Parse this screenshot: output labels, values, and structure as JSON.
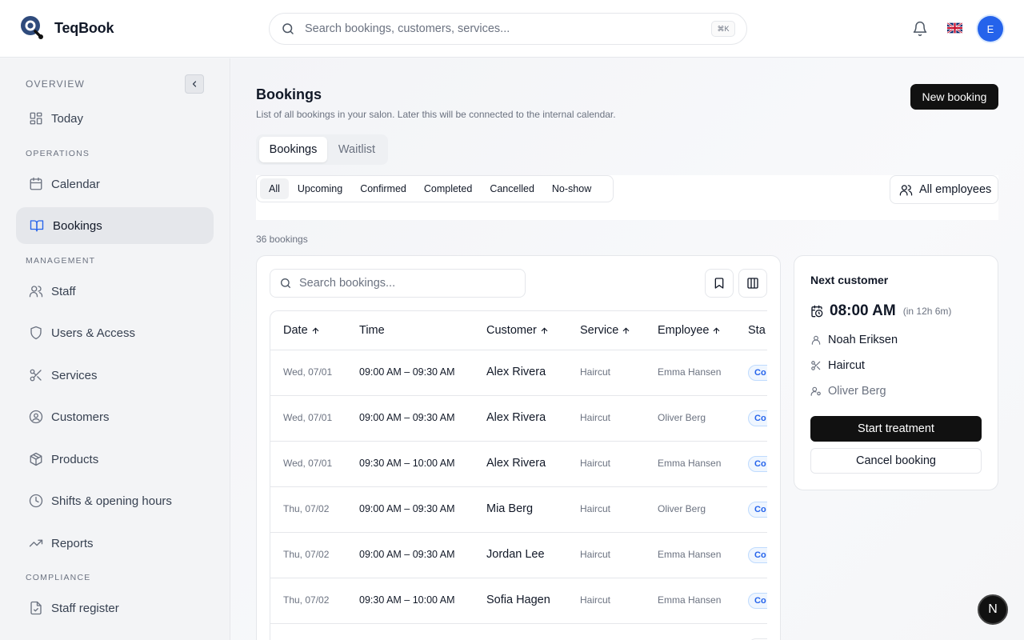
{
  "app": {
    "name": "TeqBook"
  },
  "topbar": {
    "search_placeholder": "Search bookings, customers, services...",
    "shortcut": "⌘K",
    "avatar_initial": "E",
    "language_flag": "uk-flag-icon"
  },
  "sidebar": {
    "sections": {
      "overview": "OVERVIEW",
      "operations": "OPERATIONS",
      "management": "MANAGEMENT",
      "compliance": "COMPLIANCE"
    },
    "items": [
      {
        "label": "Today",
        "icon": "dashboard-icon"
      },
      {
        "label": "Calendar",
        "icon": "calendar-icon"
      },
      {
        "label": "Bookings",
        "icon": "book-icon",
        "active": true
      },
      {
        "label": "Staff",
        "icon": "users-icon"
      },
      {
        "label": "Users & Access",
        "icon": "shield-icon"
      },
      {
        "label": "Services",
        "icon": "scissors-icon"
      },
      {
        "label": "Customers",
        "icon": "user-circle-icon"
      },
      {
        "label": "Products",
        "icon": "package-icon"
      },
      {
        "label": "Shifts & opening hours",
        "icon": "clock-icon"
      },
      {
        "label": "Reports",
        "icon": "trending-up-icon"
      },
      {
        "label": "Staff register",
        "icon": "file-check-icon"
      }
    ]
  },
  "page": {
    "title": "Bookings",
    "subtitle": "List of all bookings in your salon. Later this will be connected to the internal calendar.",
    "new_booking": "New booking",
    "tabs": [
      "Bookings",
      "Waitlist"
    ],
    "filters": [
      "All",
      "Upcoming",
      "Confirmed",
      "Completed",
      "Cancelled",
      "No-show"
    ],
    "employee_filter": "All employees",
    "count": "36 bookings"
  },
  "table": {
    "search_placeholder": "Search bookings...",
    "columns": [
      "Date",
      "Time",
      "Customer",
      "Service",
      "Employee",
      "Sta"
    ],
    "rows": [
      {
        "date": "Wed, 07/01",
        "time": "09:00 AM – 09:30 AM",
        "customer": "Alex Rivera",
        "service": "Haircut",
        "employee": "Emma Hansen",
        "status": "Co"
      },
      {
        "date": "Wed, 07/01",
        "time": "09:00 AM – 09:30 AM",
        "customer": "Alex Rivera",
        "service": "Haircut",
        "employee": "Oliver Berg",
        "status": "Co"
      },
      {
        "date": "Wed, 07/01",
        "time": "09:30 AM – 10:00 AM",
        "customer": "Alex Rivera",
        "service": "Haircut",
        "employee": "Emma Hansen",
        "status": "Co"
      },
      {
        "date": "Thu, 07/02",
        "time": "09:00 AM – 09:30 AM",
        "customer": "Mia Berg",
        "service": "Haircut",
        "employee": "Oliver Berg",
        "status": "Co"
      },
      {
        "date": "Thu, 07/02",
        "time": "09:00 AM – 09:30 AM",
        "customer": "Jordan Lee",
        "service": "Haircut",
        "employee": "Emma Hansen",
        "status": "Co"
      },
      {
        "date": "Thu, 07/02",
        "time": "09:30 AM – 10:00 AM",
        "customer": "Sofia Hagen",
        "service": "Haircut",
        "employee": "Emma Hansen",
        "status": "Co"
      }
    ]
  },
  "next_customer": {
    "title": "Next customer",
    "time": "08:00 AM",
    "relative": "(in 12h 6m)",
    "customer": "Noah Eriksen",
    "service": "Haircut",
    "employee": "Oliver Berg",
    "start": "Start treatment",
    "cancel": "Cancel booking"
  },
  "badge": "N",
  "colors": {
    "accent": "#2563eb",
    "dark": "#111111",
    "status_blue": "#2563eb"
  }
}
